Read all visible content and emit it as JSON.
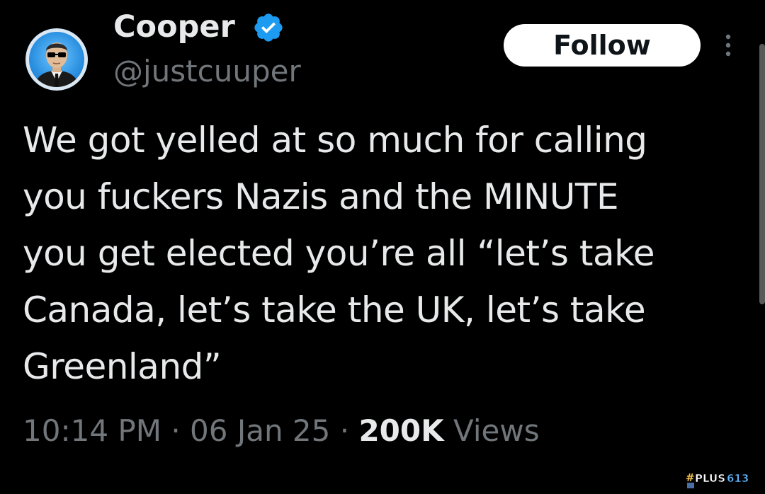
{
  "author": {
    "display_name": "Cooper",
    "handle": "@justcuuper",
    "verified": true,
    "avatar_icon": "man-in-black-suit-sunglasses-avatar",
    "verified_icon": "verified-badge-icon"
  },
  "actions": {
    "follow_label": "Follow",
    "more_icon": "vertical-ellipsis-icon"
  },
  "tweet": {
    "text": "We got yelled at so much for calling\nyou fuckers Nazis and the MINUTE\nyou get elected you’re all “let’s take\nCanada, let’s take the UK, let’s take\nGreenland”"
  },
  "meta": {
    "time": "10:14 PM",
    "separator": "·",
    "date": "06 Jan 25",
    "views_count": "200K",
    "views_label": "Views"
  },
  "watermark": {
    "text": "#PLUS613"
  },
  "colors": {
    "background": "#000000",
    "primary_text": "#e7e9ea",
    "secondary_text": "#71767b",
    "verified_blue": "#1d9bf0",
    "follow_bg": "#ffffff"
  }
}
